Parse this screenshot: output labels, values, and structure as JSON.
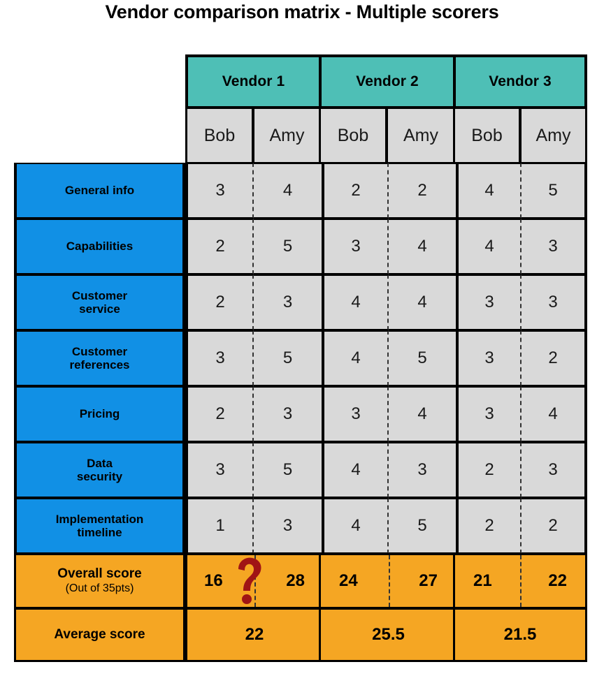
{
  "title": "Vendor comparison matrix - Multiple scorers",
  "colors": {
    "vendor_header": "#4ebfb6",
    "criteria": "#1190e5",
    "score_cell": "#d9d9d9",
    "summary": "#f5a623",
    "question_mark": "#a01515",
    "border": "#000000"
  },
  "table": {
    "corner_label": "",
    "vendors": [
      "Vendor 1",
      "Vendor 2",
      "Vendor 3"
    ],
    "scorers": [
      "Bob",
      "Amy"
    ],
    "scorer_header_row": [
      "Bob",
      "Amy",
      "Bob",
      "Amy",
      "Bob",
      "Amy"
    ],
    "criteria": [
      "General info",
      "Capabilities",
      "Customer service",
      "Customer references",
      "Pricing",
      "Data security",
      "Implementation timeline"
    ],
    "criteria_lines": [
      [
        "General info"
      ],
      [
        "Capabilities"
      ],
      [
        "Customer",
        "service"
      ],
      [
        "Customer",
        "references"
      ],
      [
        "Pricing"
      ],
      [
        "Data",
        "security"
      ],
      [
        "Implementation",
        "timeline"
      ]
    ],
    "scores": [
      [
        "3",
        "4",
        "2",
        "2",
        "4",
        "5"
      ],
      [
        "2",
        "5",
        "3",
        "4",
        "4",
        "3"
      ],
      [
        "2",
        "3",
        "4",
        "4",
        "3",
        "3"
      ],
      [
        "3",
        "5",
        "4",
        "5",
        "3",
        "2"
      ],
      [
        "2",
        "3",
        "3",
        "4",
        "3",
        "4"
      ],
      [
        "3",
        "5",
        "4",
        "3",
        "2",
        "3"
      ],
      [
        "1",
        "3",
        "4",
        "5",
        "2",
        "2"
      ]
    ],
    "overall": {
      "label": "Overall score",
      "sublabel": "(Out of 35pts)",
      "values": [
        "16",
        "28",
        "24",
        "27",
        "21",
        "22"
      ]
    },
    "average": {
      "label": "Average score",
      "values": [
        "22",
        "25.5",
        "21.5"
      ]
    },
    "marker": {
      "icon": "question-mark-icon",
      "vendor": "Vendor 1",
      "meaning": "discrepancy"
    }
  },
  "chart_data": {
    "type": "table",
    "title": "Vendor comparison matrix - Multiple scorers",
    "column_groups": [
      "Vendor 1",
      "Vendor 2",
      "Vendor 3"
    ],
    "sub_columns": [
      "Bob",
      "Amy"
    ],
    "row_labels": [
      "General info",
      "Capabilities",
      "Customer service",
      "Customer references",
      "Pricing",
      "Data security",
      "Implementation timeline"
    ],
    "series": [
      {
        "name": "Vendor 1 - Bob",
        "values": [
          3,
          2,
          2,
          3,
          2,
          3,
          1
        ],
        "total": 16
      },
      {
        "name": "Vendor 1 - Amy",
        "values": [
          4,
          5,
          3,
          5,
          3,
          5,
          3
        ],
        "total": 28
      },
      {
        "name": "Vendor 2 - Bob",
        "values": [
          2,
          3,
          4,
          4,
          3,
          4,
          4
        ],
        "total": 24
      },
      {
        "name": "Vendor 2 - Amy",
        "values": [
          2,
          4,
          4,
          5,
          4,
          3,
          5
        ],
        "total": 27
      },
      {
        "name": "Vendor 3 - Bob",
        "values": [
          4,
          4,
          3,
          3,
          3,
          2,
          2
        ],
        "total": 21
      },
      {
        "name": "Vendor 3 - Amy",
        "values": [
          5,
          3,
          3,
          2,
          4,
          3,
          2
        ],
        "total": 22
      }
    ],
    "averages": {
      "Vendor 1": 22,
      "Vendor 2": 25.5,
      "Vendor 3": 21.5
    },
    "scale_max_per_row": 5,
    "total_max": 35,
    "annotations": [
      {
        "type": "question-mark",
        "target": "Vendor 1 overall score",
        "note": "large gap between 16 and 28"
      }
    ]
  }
}
